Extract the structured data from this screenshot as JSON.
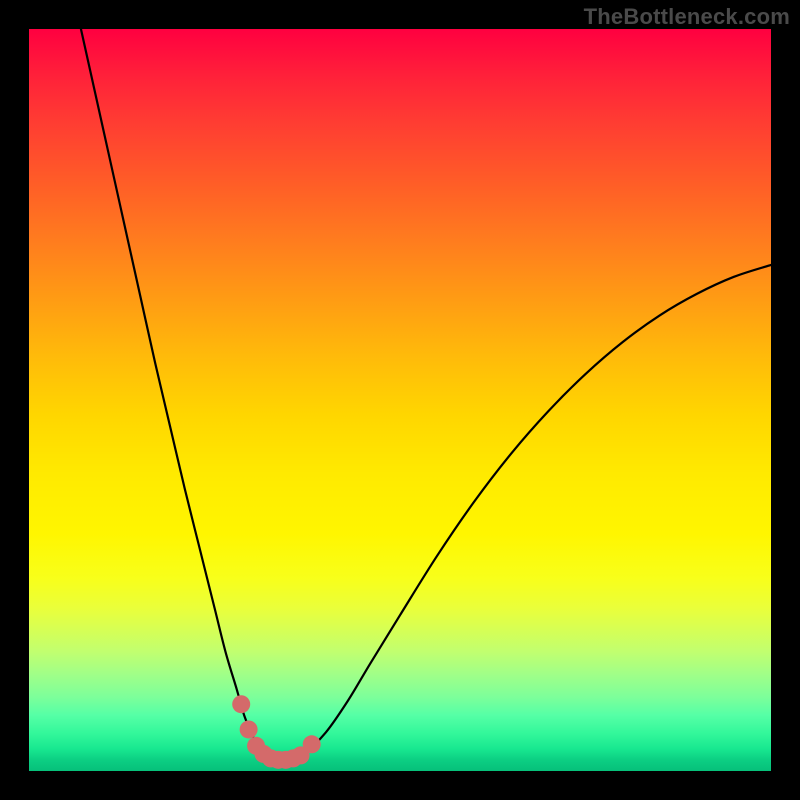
{
  "watermark": "TheBottleneck.com",
  "chart_data": {
    "type": "line",
    "title": "",
    "xlabel": "",
    "ylabel": "",
    "xlim": [
      0,
      100
    ],
    "ylim": [
      0,
      100
    ],
    "grid": false,
    "legend": false,
    "series": [
      {
        "name": "bottleneck-curve",
        "color": "#000000",
        "stroke_width": 2,
        "x": [
          7,
          9,
          11,
          13,
          15,
          17,
          19,
          21,
          23,
          25,
          26.5,
          28,
          29,
          30,
          31,
          32,
          33,
          34,
          35,
          37,
          40,
          43,
          46,
          50,
          55,
          60,
          65,
          70,
          75,
          80,
          85,
          90,
          95,
          100
        ],
        "values": [
          100,
          91,
          82,
          73,
          64,
          55,
          46.5,
          38,
          30,
          22,
          16,
          11,
          7.5,
          5,
          3.2,
          2.3,
          1.8,
          1.6,
          1.6,
          2.3,
          5.2,
          9.5,
          14.5,
          21,
          29,
          36.3,
          42.8,
          48.5,
          53.5,
          57.8,
          61.4,
          64.3,
          66.6,
          68.2
        ]
      },
      {
        "name": "marker-cluster",
        "type": "scatter",
        "color": "#d46a6a",
        "marker_radius_px": 9,
        "x": [
          28.6,
          29.6,
          30.6,
          31.6,
          32.6,
          33.6,
          34.6,
          35.6,
          36.6,
          38.1
        ],
        "values": [
          9.0,
          5.6,
          3.4,
          2.3,
          1.7,
          1.5,
          1.5,
          1.7,
          2.1,
          3.6
        ]
      }
    ],
    "background": {
      "type": "vertical-gradient",
      "stops": [
        {
          "pos": 0,
          "color": "#ff0040"
        },
        {
          "pos": 40,
          "color": "#ff9a14"
        },
        {
          "pos": 65,
          "color": "#ffee00"
        },
        {
          "pos": 85,
          "color": "#b8ff70"
        },
        {
          "pos": 100,
          "color": "#06c07a"
        }
      ]
    }
  }
}
